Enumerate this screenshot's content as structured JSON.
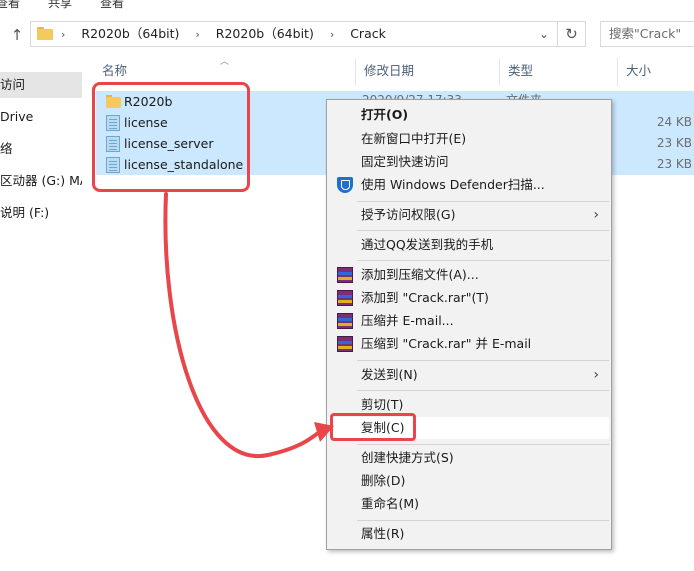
{
  "ribbon": {
    "items": [
      "查看",
      "共享",
      "查看"
    ]
  },
  "address": {
    "crumbs": [
      "R2020b（64bit)",
      "R2020b（64bit)",
      "Crack"
    ],
    "search_placeholder": "搜索\"Crack\""
  },
  "sidebar": {
    "items": [
      "访问",
      "Drive",
      "络",
      "区动器 (G:) MAT",
      "说明 (F:)"
    ]
  },
  "columns": {
    "name": "名称",
    "date": "修改日期",
    "type": "类型",
    "size": "大小"
  },
  "files": [
    {
      "name": "R2020b",
      "date": "2020/9/27 17:33",
      "type": "文件夹",
      "size": ""
    },
    {
      "name": "license",
      "date": "",
      "type": "",
      "size": "24 KB"
    },
    {
      "name": "license_server",
      "date": "",
      "type": "",
      "size": "23 KB"
    },
    {
      "name": "license_standalone",
      "date": "",
      "type": "",
      "size": "23 KB"
    }
  ],
  "context_menu": {
    "open": "打开(O)",
    "open_new_window": "在新窗口中打开(E)",
    "pin_quick_access": "固定到快速访问",
    "defender": "使用 Windows Defender扫描...",
    "grant_access": "授予访问权限(G)",
    "send_qq": "通过QQ发送到我的手机",
    "add_archive": "添加到压缩文件(A)...",
    "add_crack_rar": "添加到 \"Crack.rar\"(T)",
    "compress_email": "压缩并 E-mail...",
    "compress_crack_email": "压缩到 \"Crack.rar\" 并 E-mail",
    "send_to": "发送到(N)",
    "cut": "剪切(T)",
    "copy": "复制(C)",
    "create_shortcut": "创建快捷方式(S)",
    "delete": "删除(D)",
    "rename": "重命名(M)",
    "properties": "属性(R)"
  },
  "colors": {
    "highlight_red": "#e8464b",
    "selection_blue": "#cce8ff"
  }
}
